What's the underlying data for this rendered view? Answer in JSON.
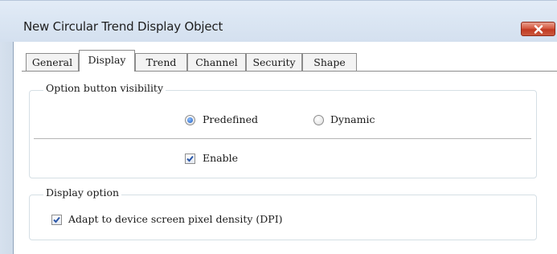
{
  "window": {
    "title": "New Circular Trend Display Object"
  },
  "tabs": [
    {
      "label": "General",
      "active": false
    },
    {
      "label": "Display",
      "active": true
    },
    {
      "label": "Trend",
      "active": false
    },
    {
      "label": "Channel",
      "active": false
    },
    {
      "label": "Security",
      "active": false
    },
    {
      "label": "Shape",
      "active": false
    }
  ],
  "option_button_visibility": {
    "legend": "Option button visibility",
    "predefined_label": "Predefined",
    "dynamic_label": "Dynamic",
    "selected": "Predefined",
    "enable_label": "Enable",
    "enable_checked": true
  },
  "display_option": {
    "legend": "Display option",
    "dpi_label": "Adapt to device screen pixel density (DPI)",
    "dpi_checked": true
  },
  "colors": {
    "accent": "#1c5bbf",
    "close_button": "#c13a22"
  }
}
